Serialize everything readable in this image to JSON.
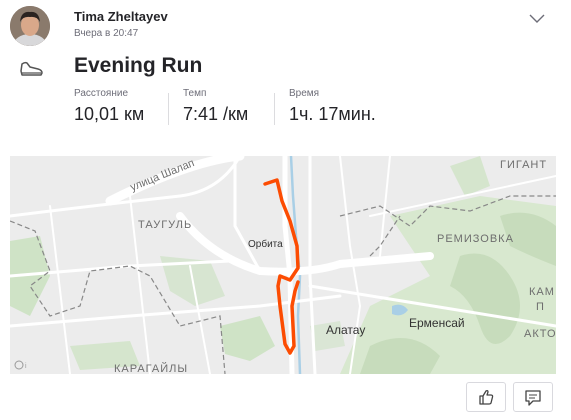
{
  "athlete": {
    "name": "Tima Zheltayev",
    "timestamp": "Вчера в 20:47"
  },
  "activity": {
    "icon": "run-shoe-icon",
    "title": "Evening Run",
    "stats": [
      {
        "label": "Расстояние",
        "value": "10,01 км"
      },
      {
        "label": "Темп",
        "value": "7:41 /км"
      },
      {
        "label": "Время",
        "value": "1ч. 17мин."
      }
    ]
  },
  "map": {
    "route_color": "#fc4c02",
    "labels": {
      "street": "улица Шалап",
      "taugul": "ТАУГУЛЬ",
      "orbita": "Орбита",
      "remizovka": "РЕМИЗОВКА",
      "alatau": "Алатау",
      "ermensay": "Ерменсай",
      "karagayly": "КАРАГАЙЛЫ",
      "gigant": "ГИГАНТ",
      "kam": "КАМ",
      "p": "П",
      "akto": "АКТО"
    }
  },
  "actions": {
    "like_icon": "thumbs-up-icon",
    "comment_icon": "comment-icon"
  }
}
